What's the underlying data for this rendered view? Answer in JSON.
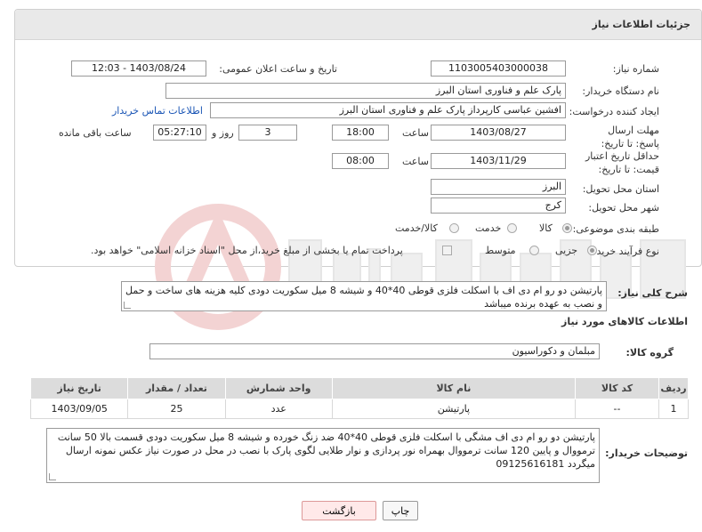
{
  "header": {
    "title": "جزئیات اطلاعات نیاز"
  },
  "fields": {
    "need_number_label": "شماره نیاز:",
    "need_number": "1103005403000038",
    "announce_label": "تاریخ و ساعت اعلان عمومی:",
    "announce_value": "1403/08/24 - 12:03",
    "buyer_org_label": "نام دستگاه خریدار:",
    "buyer_org": "پارک علم و فناوری استان البرز",
    "creator_label": "ایجاد کننده درخواست:",
    "creator": "افشین  عباسی  کارپرداز پارک علم و فناوری استان البرز",
    "contact_link": "اطلاعات تماس خریدار",
    "reply_deadline_label": "مهلت ارسال پاسخ: تا تاریخ:",
    "reply_date": "1403/08/27",
    "time_label": "ساعت",
    "reply_time": "18:00",
    "days_value": "3",
    "days_label": "روز و",
    "remaining_time": "05:27:10",
    "remaining_label": "ساعت باقی مانده",
    "price_validity_label": "حداقل تاریخ اعتبار قیمت: تا تاریخ:",
    "price_date": "1403/11/29",
    "price_time": "08:00",
    "province_label": "استان محل تحویل:",
    "province": "البرز",
    "city_label": "شهر محل تحویل:",
    "city": "کرج",
    "category_label": "طبقه بندی موضوعی:",
    "category_options": [
      "کالا",
      "خدمت",
      "کالا/خدمت"
    ],
    "process_label": "نوع فرآیند خرید :",
    "process_options": [
      "جزیی",
      "متوسط"
    ],
    "payment_note": "پرداخت تمام یا بخشی از مبلغ خرید،از محل \"اسناد خزانه اسلامی\" خواهد بود."
  },
  "summary": {
    "label": "شرح کلی نیاز:",
    "text": "پارتیشن دو رو ام دی اف با اسکلت فلزی قوطی 40*40 و شیشه 8 میل سکوریت دودی کلیه هزینه های ساخت و حمل و نصب به عهده برنده میباشد"
  },
  "goods": {
    "section_title": "اطلاعات کالاهای مورد نیاز",
    "group_label": "گروه کالا:",
    "group_value": "مبلمان و دکوراسیون",
    "columns": [
      "ردیف",
      "کد کالا",
      "نام کالا",
      "واحد شمارش",
      "تعداد / مقدار",
      "تاریخ نیاز"
    ],
    "rows": [
      [
        "1",
        "--",
        "پارتیشن",
        "عدد",
        "25",
        "1403/09/05"
      ]
    ]
  },
  "buyer_notes": {
    "label": "توضیحات خریدار:",
    "text": "پارتیشن دو رو ام دی اف مشگی با اسکلت فلزی قوطی 40*40 ضد زنگ خورده و شیشه 8 میل سکوریت دودی قسمت بالا 50 سانت ترمووال و پایین 120 سانت ترمووال بهمراه نور پردازی و نوار طلایی لگوی پارک با نصب در محل در صورت نیاز عکس نمونه ارسال میگردد    09125616181"
  },
  "buttons": {
    "back": "بازگشت",
    "print": "چاپ"
  },
  "colors": {
    "header_bg": "#e9e9e9",
    "link": "#1a55b5",
    "back_btn": "#ffe9e9"
  }
}
